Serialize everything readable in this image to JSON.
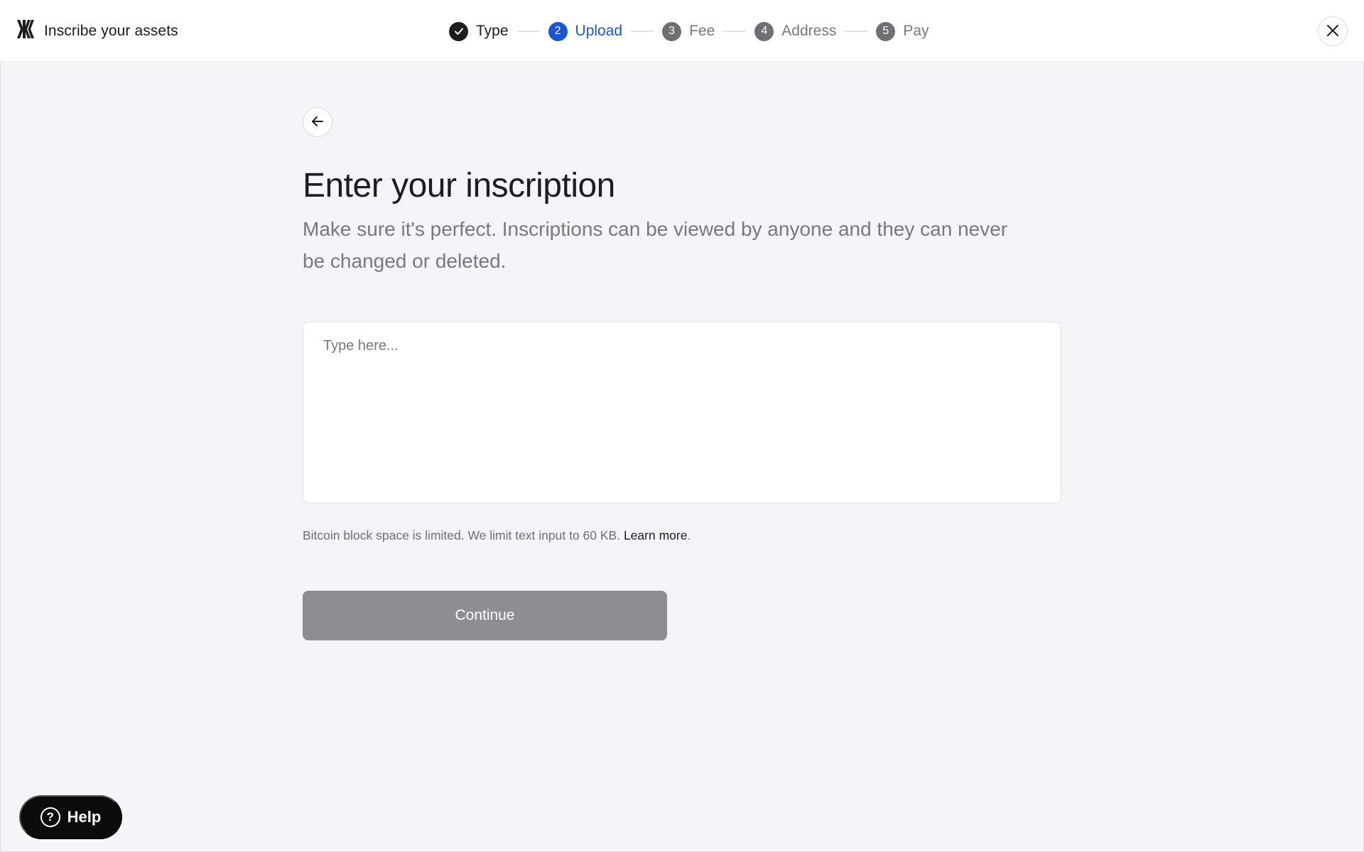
{
  "header": {
    "title": "Inscribe your assets",
    "logo_icon": "magic-eden-logo",
    "close_icon": "close-icon"
  },
  "stepper": {
    "steps": [
      {
        "number": "",
        "label": "Type",
        "state": "done",
        "icon": "checkmark-icon"
      },
      {
        "number": "2",
        "label": "Upload",
        "state": "active"
      },
      {
        "number": "3",
        "label": "Fee",
        "state": "pending"
      },
      {
        "number": "4",
        "label": "Address",
        "state": "pending"
      },
      {
        "number": "5",
        "label": "Pay",
        "state": "pending"
      }
    ]
  },
  "main": {
    "back_icon": "arrow-left-icon",
    "title": "Enter your inscription",
    "subtitle": "Make sure it's perfect. Inscriptions can be viewed by anyone and they can never be changed or deleted.",
    "textarea": {
      "placeholder": "Type here...",
      "value": ""
    },
    "hint_text": "Bitcoin block space is limited. We limit text input to 60 KB.",
    "hint_link": "Learn more",
    "hint_suffix": ".",
    "continue_label": "Continue"
  },
  "help": {
    "label": "Help",
    "icon": "question-circle-icon",
    "glyph": "?"
  },
  "colors": {
    "accent": "#1a55d6",
    "background": "#f5f5f7",
    "disabled_button": "#8e8e90"
  }
}
